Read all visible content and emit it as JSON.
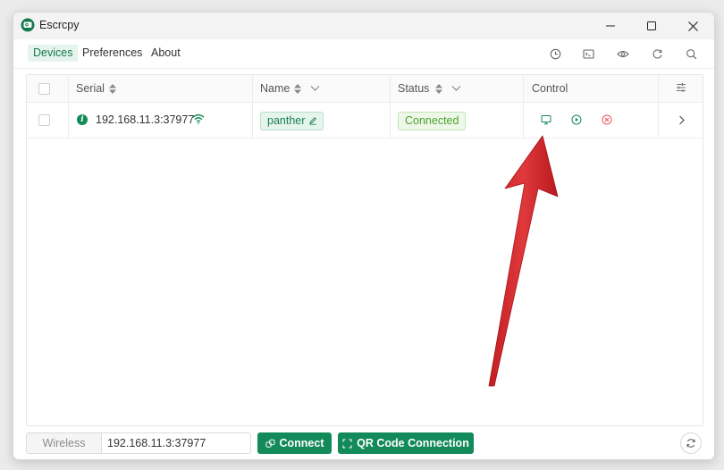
{
  "app": {
    "title": "Escrcpy",
    "accent": "#138a5a"
  },
  "tabs": [
    {
      "label": "Devices",
      "active": true
    },
    {
      "label": "Preferences",
      "active": false
    },
    {
      "label": "About",
      "active": false
    }
  ],
  "toolbar_icons": [
    "clock-icon",
    "terminal-icon",
    "eye-icon",
    "refresh-icon",
    "search-icon"
  ],
  "table": {
    "columns": [
      "Serial",
      "Name",
      "Status",
      "Control"
    ],
    "rows": [
      {
        "serial": "192.168.11.3:37977",
        "name": "panther",
        "status": "Connected"
      }
    ]
  },
  "bottom": {
    "wireless_label": "Wireless",
    "address_value": "192.168.11.3:37977",
    "connect_label": "Connect",
    "qr_label": "QR Code Connection"
  },
  "colors": {
    "status_connected": "#4ba02e",
    "stop_icon": "#e8555b",
    "annotation_arrow": "#d02a2a"
  }
}
